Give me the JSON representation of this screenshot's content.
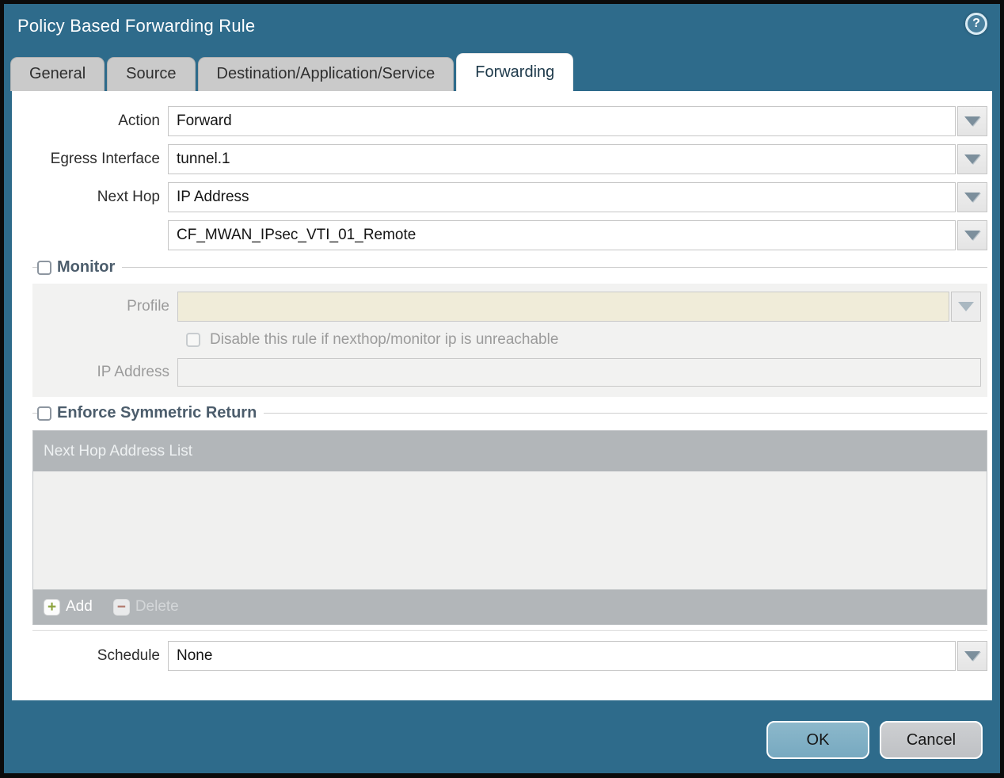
{
  "dialog": {
    "title": "Policy Based Forwarding Rule",
    "help_glyph": "?"
  },
  "tabs": [
    {
      "label": "General",
      "active": false
    },
    {
      "label": "Source",
      "active": false
    },
    {
      "label": "Destination/Application/Service",
      "active": false
    },
    {
      "label": "Forwarding",
      "active": true
    }
  ],
  "form": {
    "action": {
      "label": "Action",
      "value": "Forward"
    },
    "egress_interface": {
      "label": "Egress Interface",
      "value": "tunnel.1"
    },
    "next_hop": {
      "label": "Next Hop",
      "value": "IP Address"
    },
    "next_hop_address": {
      "value": "CF_MWAN_IPsec_VTI_01_Remote"
    },
    "schedule": {
      "label": "Schedule",
      "value": "None"
    }
  },
  "monitor": {
    "legend": "Monitor",
    "checked": false,
    "profile": {
      "label": "Profile",
      "value": ""
    },
    "disable_rule_label": "Disable this rule if nexthop/monitor ip is unreachable",
    "disable_rule_checked": false,
    "ip_address": {
      "label": "IP Address",
      "value": ""
    }
  },
  "symmetric_return": {
    "legend": "Enforce Symmetric Return",
    "checked": false,
    "table_header": "Next Hop Address List",
    "rows": [],
    "add_label": "Add",
    "add_glyph": "+",
    "delete_label": "Delete",
    "delete_glyph": "−",
    "delete_enabled": false
  },
  "footer": {
    "ok_label": "OK",
    "cancel_label": "Cancel"
  },
  "colors": {
    "titlebar_teal": "#2e6b8b",
    "active_tab_text": "#1e3a4b",
    "profile_field_bg": "#f0ecd9",
    "table_chrome_gray": "#b2b6b9",
    "add_green": "#8ba23b",
    "delete_red": "#b1786c",
    "ok_button_blue": "#7fb0c6"
  }
}
